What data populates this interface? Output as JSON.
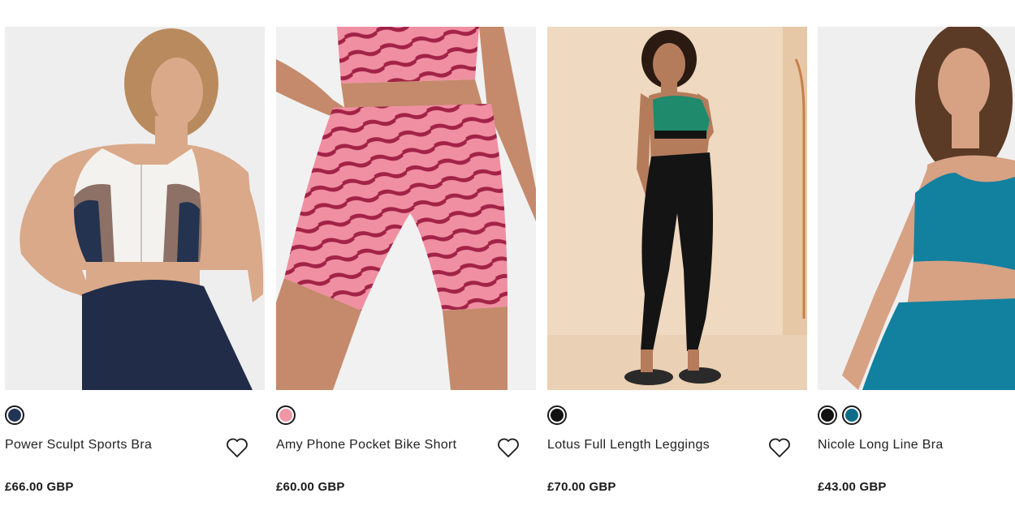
{
  "products": [
    {
      "name": "Power Sculpt Sports Bra",
      "price": "£66.00 GBP",
      "swatches": [
        "#223556"
      ],
      "image_colors": {
        "bg": "#eeeeee",
        "skin": "#d9a98a",
        "hair": "#b98a5e",
        "top_main": "#f4f2ee",
        "top_accent": "#8d7166",
        "top_side": "#24334f",
        "bottom": "#202c48"
      },
      "wishlist_icon": "heart-outline-icon"
    },
    {
      "name": "Amy Phone Pocket Bike Short",
      "price": "£60.00 GBP",
      "swatches": [
        "#ef97a7"
      ],
      "image_colors": {
        "bg": "#f1f1f1",
        "skin": "#c48a6b",
        "print_base": "#f08fa2",
        "print_stripe": "#a22347"
      },
      "wishlist_icon": "heart-outline-icon"
    },
    {
      "name": "Lotus Full Length Leggings",
      "price": "£70.00 GBP",
      "swatches": [
        "#111111"
      ],
      "image_colors": {
        "bg": "#efd9c0",
        "skin": "#b57c5c",
        "bra": "#1f8a6c",
        "leggings": "#141414",
        "shoes": "#2a2a2a"
      },
      "wishlist_icon": "heart-outline-icon"
    },
    {
      "name": "Nicole Long Line Bra",
      "price": "£43.00 GBP",
      "swatches": [
        "#111111",
        "#0d6d88"
      ],
      "image_colors": {
        "bg": "#efefef",
        "skin": "#d7a183",
        "hair": "#5b3a26",
        "garment": "#12809f"
      },
      "wishlist_icon": "heart-outline-icon"
    }
  ]
}
